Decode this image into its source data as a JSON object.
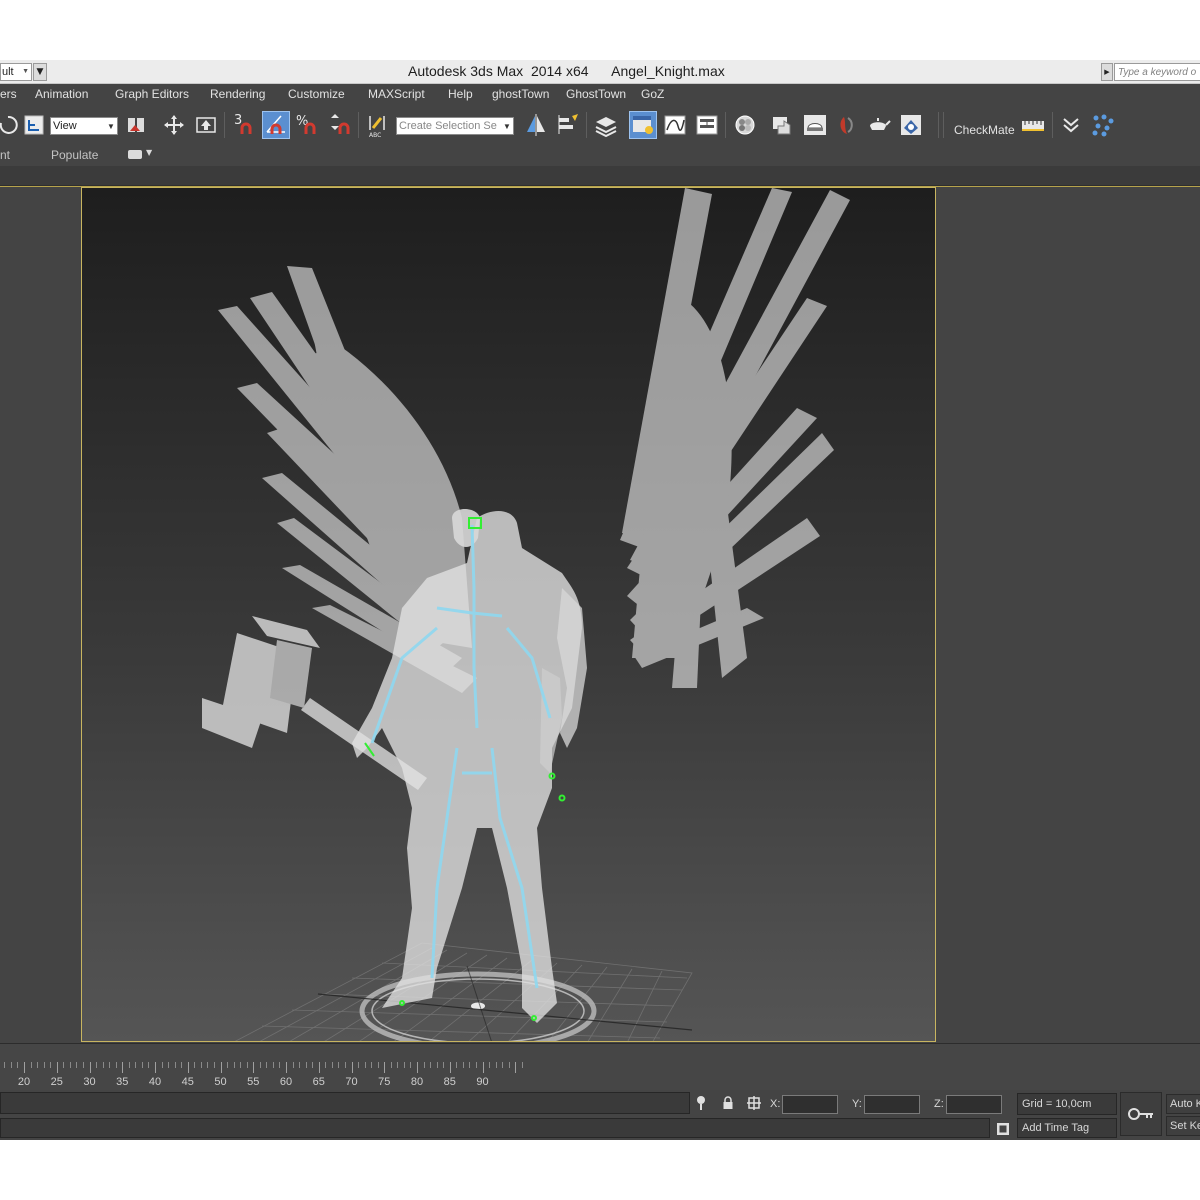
{
  "titlebar": {
    "workspace": "ult",
    "title": "Autodesk 3ds Max  2014 x64      Angel_Knight.max",
    "search_placeholder": "Type a keyword o"
  },
  "menu": [
    "ers",
    "Animation",
    "Graph Editors",
    "Rendering",
    "Customize",
    "MAXScript",
    "Help",
    "ghostTown",
    "GhostTown",
    "GoZ"
  ],
  "toolbar": {
    "ref_coord": "View",
    "selection_set": "Create Selection Se",
    "snap_number": "3",
    "checkmate": "CheckMate",
    "icons": [
      "select-rotate-icon",
      "reference-coord-icon",
      "pivot-icon",
      "move-icon",
      "place-icon",
      "snap-toggle-icon",
      "angle-snap-icon",
      "percent-snap-icon",
      "spinner-snap-icon",
      "edit-named-selection-icon",
      "mirror-icon",
      "align-icon",
      "layer-manager-icon",
      "toggle-scene-explorer-icon",
      "curve-editor-icon",
      "schematic-view-icon",
      "material-editor-icon",
      "render-setup-icon",
      "rendered-frame-icon",
      "render-production-icon",
      "render-iterative-icon",
      "teapot-icon",
      "cube-icon",
      "ruler-icon",
      "chevron-down-icon",
      "particle-icon"
    ]
  },
  "ribbon": {
    "left_label": "nt",
    "populate": "Populate"
  },
  "accent_colors": {
    "viewport_border": "#c8b560",
    "active_button": "#5b8fd0",
    "bones": "#8fd8f0",
    "gizmo": "#33ee33"
  },
  "timeline": {
    "labels": [
      "20",
      "25",
      "30",
      "35",
      "40",
      "45",
      "50",
      "55",
      "60",
      "65",
      "70",
      "75",
      "80",
      "85",
      "90"
    ]
  },
  "status": {
    "x_label": "X:",
    "y_label": "Y:",
    "z_label": "Z:",
    "x_value": "",
    "y_value": "",
    "z_value": "",
    "grid": "Grid = 10,0cm",
    "add_time_tag": "Add Time Tag",
    "auto_key": "Auto K",
    "set_key": "Set Ke"
  }
}
